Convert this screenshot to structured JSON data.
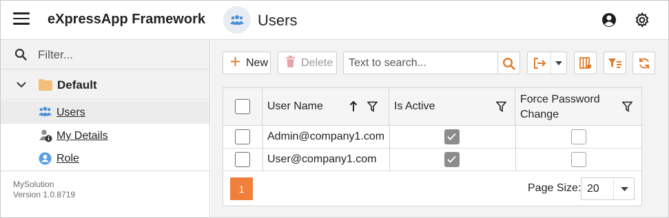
{
  "header": {
    "app_title": "eXpressApp Framework",
    "view_title": "Users"
  },
  "sidebar": {
    "filter_placeholder": "Filter...",
    "group_label": "Default",
    "items": [
      {
        "label": "Users",
        "icon": "users-icon"
      },
      {
        "label": "My Details",
        "icon": "user-info-icon"
      },
      {
        "label": "Role",
        "icon": "role-icon"
      }
    ],
    "footer": {
      "solution": "MySolution",
      "version": "Version 1.0.8719"
    }
  },
  "toolbar": {
    "new_label": "New",
    "delete_label": "Delete",
    "search_placeholder": "Text to search..."
  },
  "grid": {
    "columns": [
      "User Name",
      "Is Active",
      "Force Password Change"
    ],
    "rows": [
      {
        "user_name": "Admin@company1.com",
        "is_active": true,
        "force_password_change": false
      },
      {
        "user_name": "User@company1.com",
        "is_active": true,
        "force_password_change": false
      }
    ],
    "sort": {
      "column": "User Name",
      "direction": "ascending"
    }
  },
  "pager": {
    "current_page": "1",
    "page_size_label": "Page Size:",
    "page_size": "20"
  },
  "colors": {
    "accent": "#f07f3c",
    "icon_orange": "#e07b2c",
    "icon_blue": "#4a90d9"
  }
}
